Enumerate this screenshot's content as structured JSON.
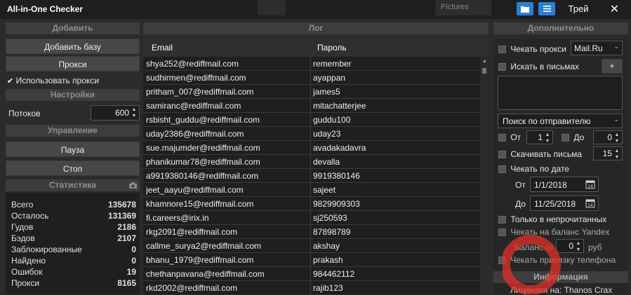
{
  "app": {
    "title": "All-in-One Checker",
    "tray_label": "Трей",
    "close_label": "✕",
    "bg_label": "Pictures"
  },
  "left": {
    "add_header": "Добавить",
    "add_base": "Добавить базу",
    "proxies": "Прокси",
    "use_proxies": "Использовать прокси",
    "settings_header": "Настройки",
    "threads_label": "Потоков",
    "threads_value": "600",
    "control_header": "Управление",
    "pause": "Пауза",
    "stop": "Стоп",
    "stats_header": "Статистика",
    "stats": [
      {
        "k": "Всего",
        "v": "135678"
      },
      {
        "k": "Осталось",
        "v": "131369"
      },
      {
        "k": "Гудов",
        "v": "2186"
      },
      {
        "k": "Бэдов",
        "v": "2107"
      },
      {
        "k": "Заблокированные",
        "v": "0"
      },
      {
        "k": "Найдено",
        "v": "0"
      },
      {
        "k": "Ошибок",
        "v": "19"
      },
      {
        "k": "Прокси",
        "v": "8165"
      }
    ]
  },
  "log": {
    "header": "Лог",
    "col_email": "Email",
    "col_password": "Пароль",
    "rows": [
      [
        "shya252@rediffmail.com",
        "remember"
      ],
      [
        "sudhirmen@rediffmail.com",
        "ayappan"
      ],
      [
        "pritham_007@rediffmail.com",
        "james5"
      ],
      [
        "samiranc@rediffmail.com",
        "mitachatterjee"
      ],
      [
        "rsbisht_guddu@rediffmail.com",
        "guddu100"
      ],
      [
        "uday2386@rediffmail.com",
        "uday23"
      ],
      [
        "sue.majumder@rediffmail.com",
        "avadakadavra"
      ],
      [
        "phanikumar78@rediffmail.com",
        "devalla"
      ],
      [
        "a9919380146@rediffmail.com",
        "9919380146"
      ],
      [
        "jeet_aayu@rediffmail.com",
        "sajeet"
      ],
      [
        "khamnore15@rediffmail.com",
        "9829909303"
      ],
      [
        "fi.careers@irix.in",
        "sj250593"
      ],
      [
        "rkg2091@rediffmail.com",
        "87898789"
      ],
      [
        "callme_surya2@rediffmail.com",
        "akshay"
      ],
      [
        "bhanu_1979@rediffmail.com",
        "prakash"
      ],
      [
        "chethanpavana@rediffmail.com",
        "984462112"
      ],
      [
        "rkd2002@rediffmail.com",
        "rajib123"
      ]
    ]
  },
  "right": {
    "header": "Дополнительно",
    "check_proxy": "Чекать прокси",
    "provider": "Mail.Ru",
    "search_letters": "Искать в письмах",
    "plus": "+",
    "search_mode": "Поиск по отправителю",
    "from_label": "От",
    "from_value": "1",
    "to_label": "До",
    "to_value": "0",
    "download_letters": "Скачивать письма",
    "download_value": "15",
    "check_date": "Чекать по дате",
    "date_from_label": "От",
    "date_from": "1/1/2018",
    "date_to_label": "До",
    "date_to": "11/25/2018",
    "unread_only": "Только в непрочитанных",
    "check_yandex": "Чекать на баланс Yandex",
    "balance_from": "Баланс от",
    "balance_value": "0",
    "balance_unit": "руб",
    "check_phone": "Чекать привязку телефона",
    "info_header": "Информация",
    "license": "Лицензия на: Thanos Crax"
  },
  "colors": {
    "accent": "#2a7fd4",
    "bg": "#2b2b2b",
    "panel": "#1f1f1f",
    "watermark": "#e0302a"
  }
}
